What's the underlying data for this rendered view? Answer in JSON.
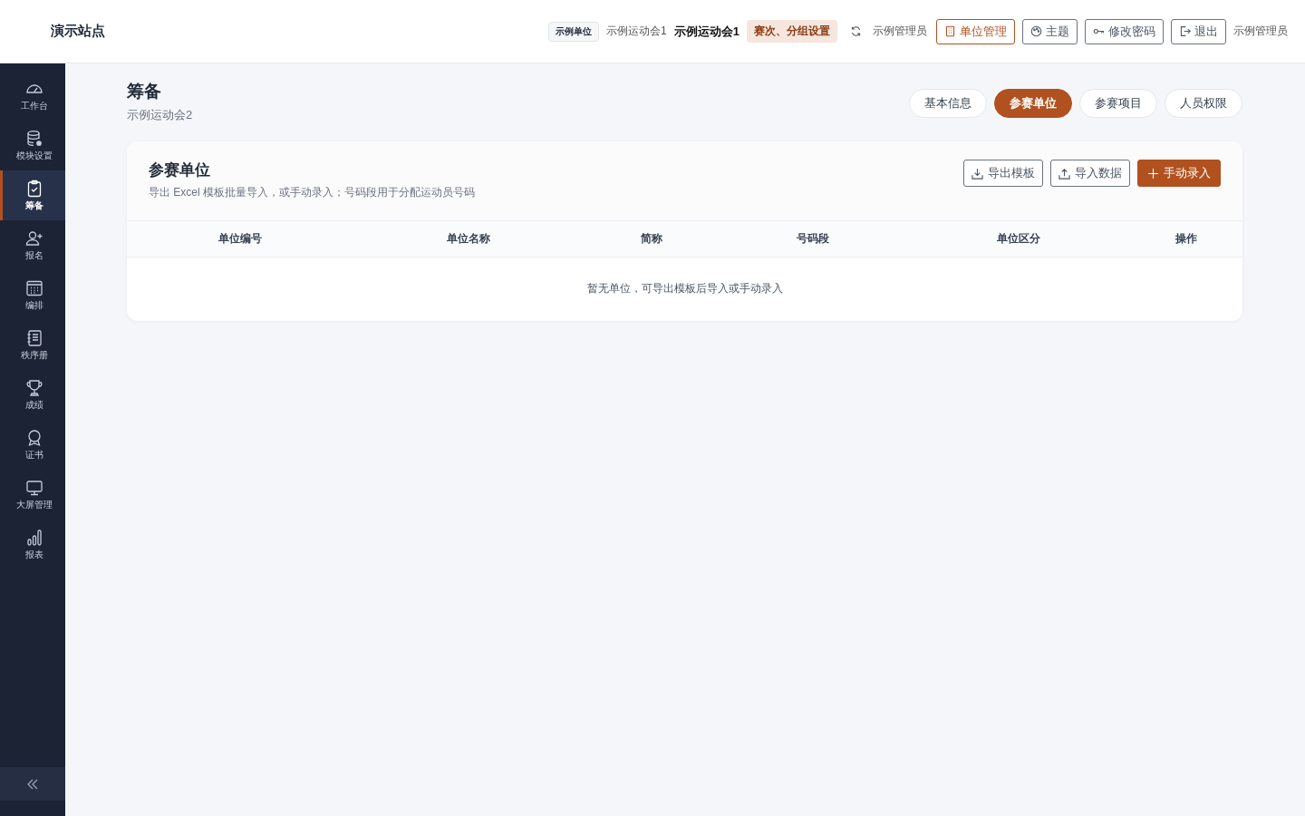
{
  "site_title": "演示站点",
  "header": {
    "org_badge": "示例单位",
    "event_small": "示例运动会1",
    "event_current": "示例运动会1",
    "round_tag": "赛次、分组设置",
    "user_label": "示例管理员",
    "buttons": [
      {
        "label": "单位管理",
        "selected": true
      },
      {
        "label": "主题",
        "selected": false
      },
      {
        "label": "修改密码",
        "selected": false
      },
      {
        "label": "退出",
        "selected": false
      }
    ],
    "user_name": "示例管理员"
  },
  "sidebar": {
    "items": [
      {
        "label": "工作台",
        "selected": false
      },
      {
        "label": "模块设置",
        "selected": false
      },
      {
        "label": "筹备",
        "selected": true
      },
      {
        "label": "报名",
        "selected": false
      },
      {
        "label": "编排",
        "selected": false
      },
      {
        "label": "秩序册",
        "selected": false
      },
      {
        "label": "成绩",
        "selected": false
      },
      {
        "label": "证书",
        "selected": false
      },
      {
        "label": "大屏管理",
        "selected": false
      },
      {
        "label": "报表",
        "selected": false
      }
    ]
  },
  "page": {
    "title": "筹备",
    "subtitle": "示例运动会2",
    "tabs": [
      {
        "label": "基本信息",
        "selected": false
      },
      {
        "label": "参赛单位",
        "selected": true
      },
      {
        "label": "参赛项目",
        "selected": false
      },
      {
        "label": "人员权限",
        "selected": false
      }
    ]
  },
  "card": {
    "title": "参赛单位",
    "description": "导出 Excel 模板批量导入，或手动录入；号码段用于分配运动员号码",
    "actions": [
      {
        "label": "导出模板",
        "kind": "export"
      },
      {
        "label": "导入数据",
        "kind": "import"
      },
      {
        "label": "手动录入",
        "kind": "add"
      }
    ],
    "table": {
      "columns": [
        "单位编号",
        "单位名称",
        "简称",
        "号码段",
        "单位区分",
        "操作"
      ],
      "empty_message": "暂无单位，可导出模板后导入或手动录入"
    }
  }
}
